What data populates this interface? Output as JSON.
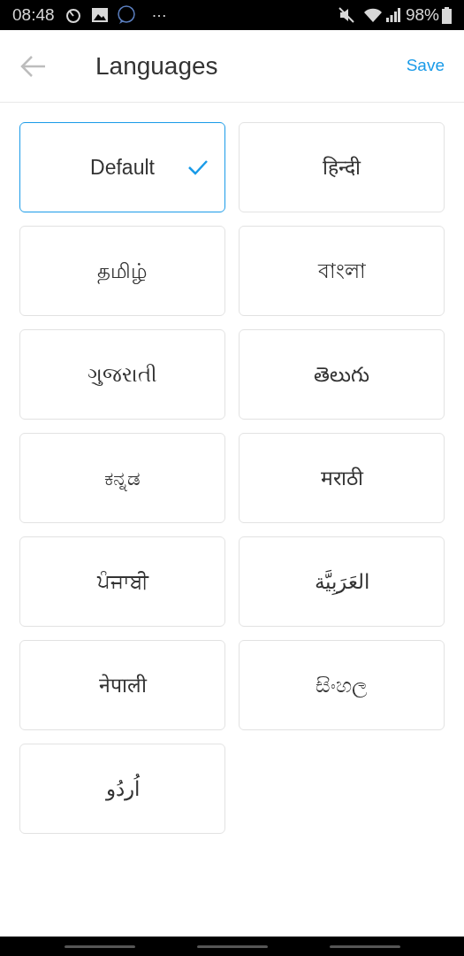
{
  "status_bar": {
    "time": "08:48",
    "overflow": "···",
    "battery": "98%"
  },
  "header": {
    "title": "Languages",
    "action": "Save"
  },
  "languages": [
    {
      "label": "Default",
      "selected": true
    },
    {
      "label": "हिन्दी",
      "selected": false
    },
    {
      "label": "தமிழ்",
      "selected": false
    },
    {
      "label": "বাংলা",
      "selected": false
    },
    {
      "label": "ગુજરાતી",
      "selected": false
    },
    {
      "label": "తెలుగు",
      "selected": false
    },
    {
      "label": "ಕನ್ನಡ",
      "selected": false
    },
    {
      "label": "मराठी",
      "selected": false
    },
    {
      "label": "ਪੰਜਾਬੀ",
      "selected": false
    },
    {
      "label": "العَرَبِيَّة",
      "selected": false
    },
    {
      "label": "नेपाली",
      "selected": false
    },
    {
      "label": "සිංහල",
      "selected": false
    },
    {
      "label": "اُردُو",
      "selected": false
    }
  ]
}
